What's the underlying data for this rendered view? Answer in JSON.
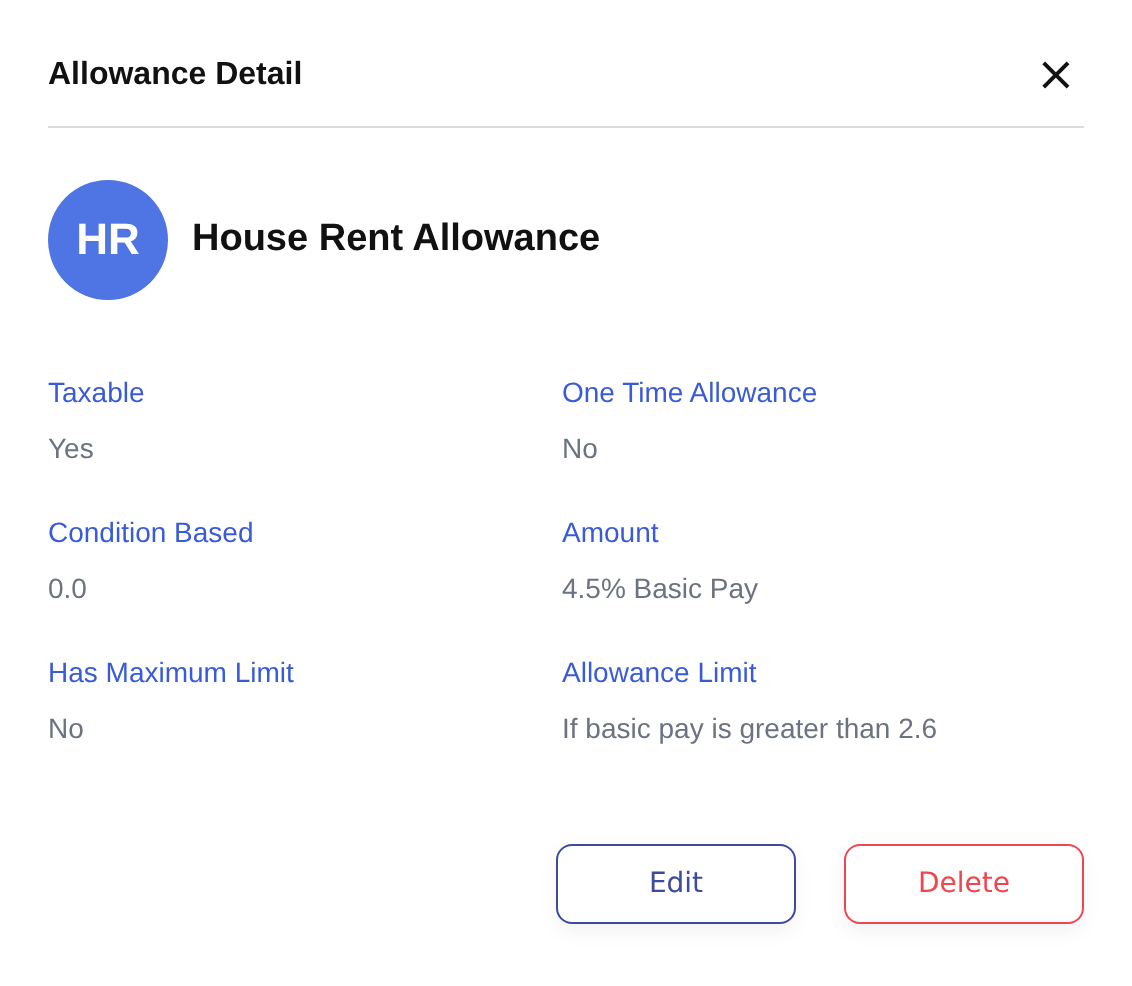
{
  "dialog": {
    "title": "Allowance Detail",
    "close": "×"
  },
  "header": {
    "initials": "HR",
    "name": "House Rent Allowance"
  },
  "fields": [
    {
      "label": "Taxable",
      "value": "Yes"
    },
    {
      "label": "One Time Allowance",
      "value": "No"
    },
    {
      "label": "Condition Based",
      "value": "0.0"
    },
    {
      "label": "Amount",
      "value": "4.5% Basic Pay"
    },
    {
      "label": "Has Maximum Limit",
      "value": "No"
    },
    {
      "label": "Allowance Limit",
      "value": "If basic pay is greater than 2.6"
    }
  ],
  "buttons": [
    {
      "label": "Edit",
      "kind": "primary"
    },
    {
      "label": "Delete",
      "kind": "danger"
    }
  ]
}
